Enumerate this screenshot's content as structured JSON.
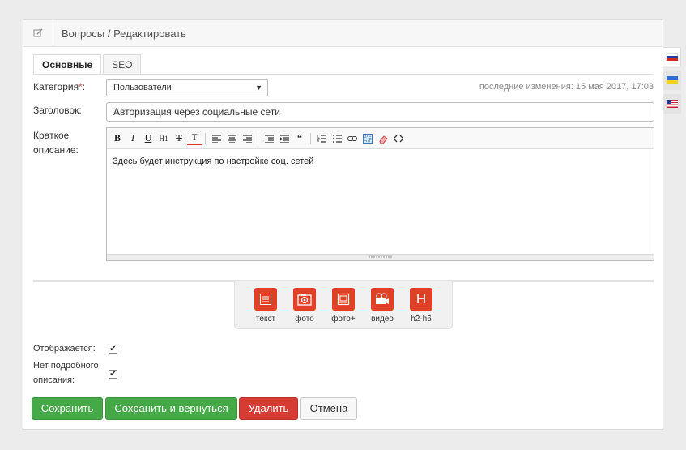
{
  "header": {
    "title": "Вопросы / Редактировать",
    "icon": "edit-icon"
  },
  "tabs": [
    {
      "label": "Основные",
      "active": true
    },
    {
      "label": "SEO",
      "active": false
    }
  ],
  "form": {
    "category_label": "Категория",
    "category_required": "*",
    "category_colon": ":",
    "category_value": "Пользователи",
    "last_modified": "последние изменения: 15 мая 2017, 17:03",
    "title_label": "Заголовок:",
    "title_value": "Авторизация через социальные сети",
    "short_desc_label_1": "Краткое",
    "short_desc_label_2": "описание:",
    "short_desc_value": "Здесь будет инструкция по настройке соц. сетей"
  },
  "toolbar": {
    "bold": "B",
    "italic": "I",
    "underline": "U",
    "h1": "H1",
    "clear_format": "T",
    "text_color": "T",
    "quote": "“"
  },
  "blocks": [
    {
      "label": "текст",
      "icon": "text-block-icon"
    },
    {
      "label": "фото",
      "icon": "camera-icon"
    },
    {
      "label": "фото+",
      "icon": "gallery-icon"
    },
    {
      "label": "видео",
      "icon": "video-camera-icon"
    },
    {
      "label": "h2-h6",
      "icon": "heading-icon",
      "glyph": "H"
    }
  ],
  "checkboxes": {
    "visible_label": "Отображается:",
    "visible_checked": true,
    "no_detail_label_1": "Нет подробного",
    "no_detail_label_2": "описания:",
    "no_detail_checked": true
  },
  "buttons": {
    "save": "Сохранить",
    "save_return": "Сохранить и вернуться",
    "delete": "Удалить",
    "cancel": "Отмена"
  },
  "languages": [
    {
      "name": "ru-flag-icon",
      "active": true
    },
    {
      "name": "ua-flag-icon",
      "active": false
    },
    {
      "name": "us-flag-icon",
      "active": false
    }
  ],
  "colors": {
    "accent_red": "#e04126",
    "save_green": "#46a948",
    "delete_red": "#d63c33"
  }
}
